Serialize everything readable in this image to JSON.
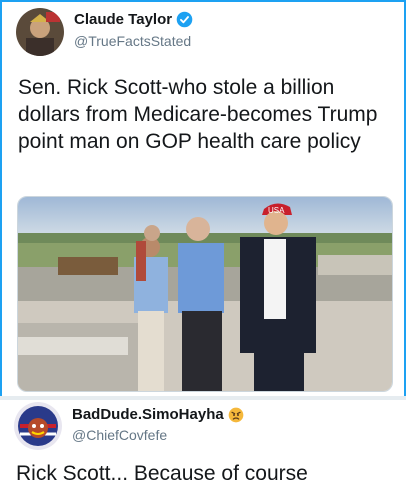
{
  "tweet_main": {
    "display_name": "Claude Taylor",
    "handle": "@TrueFactsStated",
    "verified": true,
    "text": "Sen. Rick Scott-who stole a billion dollars from Medicare-becomes Trump point man on GOP health care policy",
    "photo_cap_text": "USA"
  },
  "tweet_reply": {
    "display_name": "BadDude.SimoHayha",
    "name_emoji": "angry-face-icon",
    "handle": "@ChiefCovfefe",
    "text": "Rick Scott... Because of course"
  },
  "colors": {
    "accent": "#1da1f2",
    "divider": "#e6ecf0",
    "text": "#14171a",
    "muted": "#657786"
  }
}
